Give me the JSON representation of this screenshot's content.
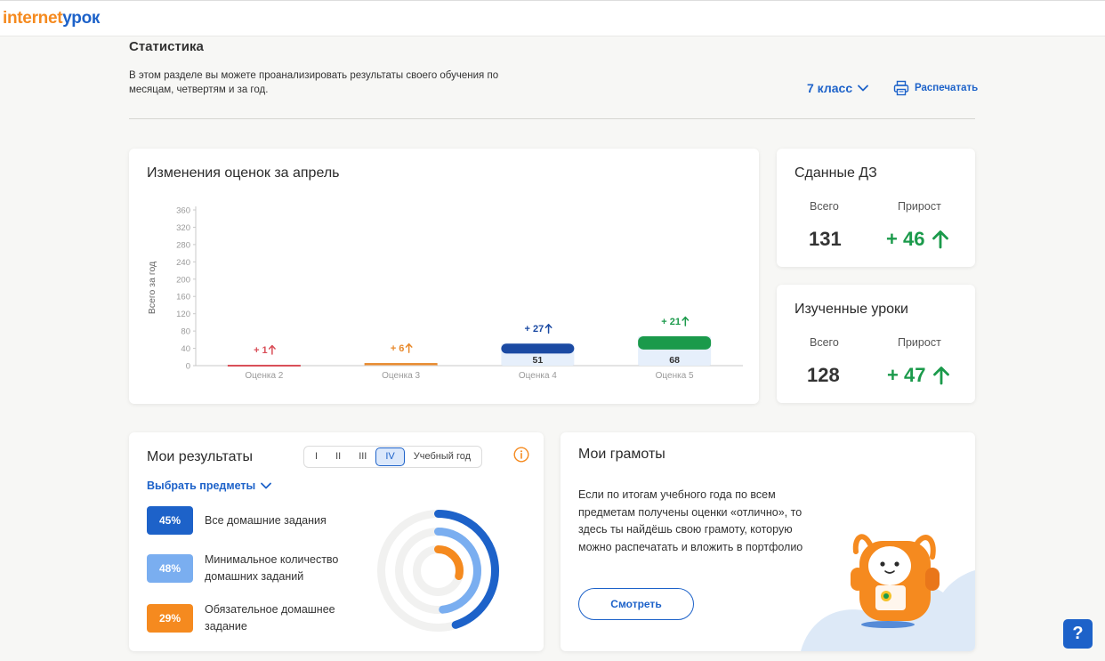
{
  "brand": {
    "logo_part1": "internet",
    "logo_part2": "урок"
  },
  "header": {
    "title": "Статистика",
    "description": "В этом разделе вы можете проанализировать результаты своего обучения по месяцам, четвертям и за год.",
    "class_label": "7 класс",
    "print_label": "Распечатать"
  },
  "chart_card": {
    "title": "Изменения оценок за апрель",
    "bar_labels": [
      "",
      "",
      "51",
      "68"
    ],
    "delta_labels": [
      "+ 1",
      "+ 6",
      "+ 27",
      "+ 21"
    ]
  },
  "chart_data": {
    "type": "bar",
    "title": "Изменения оценок за апрель",
    "ylabel": "Всего за год",
    "xlabel": "",
    "categories": [
      "Оценка 2",
      "Оценка 3",
      "Оценка 4",
      "Оценка 5"
    ],
    "yticks": [
      0,
      40,
      80,
      120,
      160,
      200,
      240,
      280,
      320,
      360
    ],
    "ylim": [
      0,
      360
    ],
    "series": [
      {
        "name": "Всего",
        "values": [
          2,
          6,
          51,
          68
        ]
      },
      {
        "name": "Прирост",
        "values": [
          1,
          6,
          27,
          21
        ]
      }
    ],
    "colors": [
      "#d94d57",
      "#e8892c",
      "#1b4aa3",
      "#1b9a4b"
    ],
    "grid": false
  },
  "hw_card": {
    "title": "Сданные ДЗ",
    "total_label": "Всего",
    "growth_label": "Прирост",
    "total": "131",
    "growth": "+ 46"
  },
  "lessons_card": {
    "title": "Изученные уроки",
    "total_label": "Всего",
    "growth_label": "Прирост",
    "total": "128",
    "growth": "+ 47"
  },
  "results_card": {
    "title": "Мои результаты",
    "periods": [
      "I",
      "II",
      "III",
      "IV",
      "Учебный год"
    ],
    "active_period": "IV",
    "subjects_link": "Выбрать предметы",
    "legend": [
      {
        "value": "45%",
        "label": "Все домашние задания",
        "color": "#1d62c9"
      },
      {
        "value": "48%",
        "label": "Минимальное количество домашних заданий",
        "color": "#7aaef0"
      },
      {
        "value": "29%",
        "label": "Обязательное домашнее задание",
        "color": "#f58a1f"
      }
    ],
    "rings": [
      {
        "fraction": 0.45,
        "color": "#1d62c9"
      },
      {
        "fraction": 0.48,
        "color": "#7aaef0"
      },
      {
        "fraction": 0.29,
        "color": "#f58a1f"
      }
    ]
  },
  "awards_card": {
    "title": "Мои грамоты",
    "description": "Если по итогам учебного года по всем предметам получены оценки «отлично», то здесь ты найдёшь свою грамоту, которую можно распечатать и вложить в портфолио",
    "button_label": "Смотреть"
  },
  "help": {
    "label": "?"
  }
}
